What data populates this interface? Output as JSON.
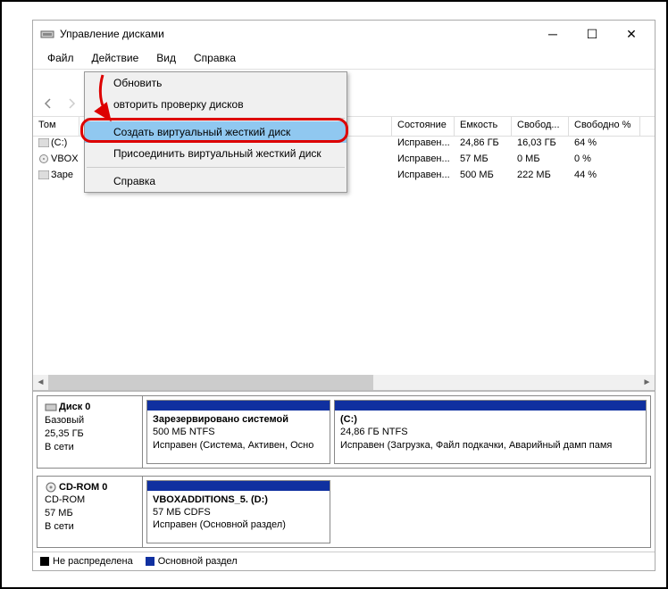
{
  "window": {
    "title": "Управление дисками"
  },
  "menubar": {
    "file": "Файл",
    "action": "Действие",
    "view": "Вид",
    "help": "Справка"
  },
  "menu": {
    "refresh": "Обновить",
    "rescan": "овторить проверку дисков",
    "createvhd": "Создать виртуальный жесткий диск",
    "attachvhd": "Присоединить виртуальный жесткий диск",
    "help": "Справка"
  },
  "table": {
    "cols": {
      "vol": "Том",
      "state": "Состояние",
      "cap": "Емкость",
      "free": "Свобод...",
      "pct": "Свободно %"
    },
    "rows": [
      {
        "vol": "(C:)",
        "state": "Исправен...",
        "cap": "24,86 ГБ",
        "free": "16,03 ГБ",
        "pct": "64 %"
      },
      {
        "vol": "VBOX",
        "state": "Исправен...",
        "cap": "57 МБ",
        "free": "0 МБ",
        "pct": "0 %"
      },
      {
        "vol": "Заре",
        "state": "Исправен...",
        "cap": "500 МБ",
        "free": "222 МБ",
        "pct": "44 %"
      }
    ]
  },
  "disks": {
    "d0": {
      "name": "Диск 0",
      "type": "Базовый",
      "size": "25,35 ГБ",
      "status": "В сети",
      "p1": {
        "title": "Зарезервировано системой",
        "line2": "500 МБ NTFS",
        "line3": "Исправен (Система, Активен, Осно"
      },
      "p2": {
        "title": "(C:)",
        "line2": "24,86 ГБ NTFS",
        "line3": "Исправен (Загрузка, Файл подкачки, Аварийный дамп памя"
      }
    },
    "cd": {
      "name": "CD-ROM 0",
      "type": "CD-ROM",
      "size": "57 МБ",
      "status": "В сети",
      "p1": {
        "title": "VBOXADDITIONS_5.  (D:)",
        "line2": "57 МБ CDFS",
        "line3": "Исправен (Основной раздел)"
      }
    }
  },
  "legend": {
    "unalloc": "Не распределена",
    "primary": "Основной раздел"
  },
  "colors": {
    "primary": "#1030a0",
    "unalloc": "#000"
  }
}
